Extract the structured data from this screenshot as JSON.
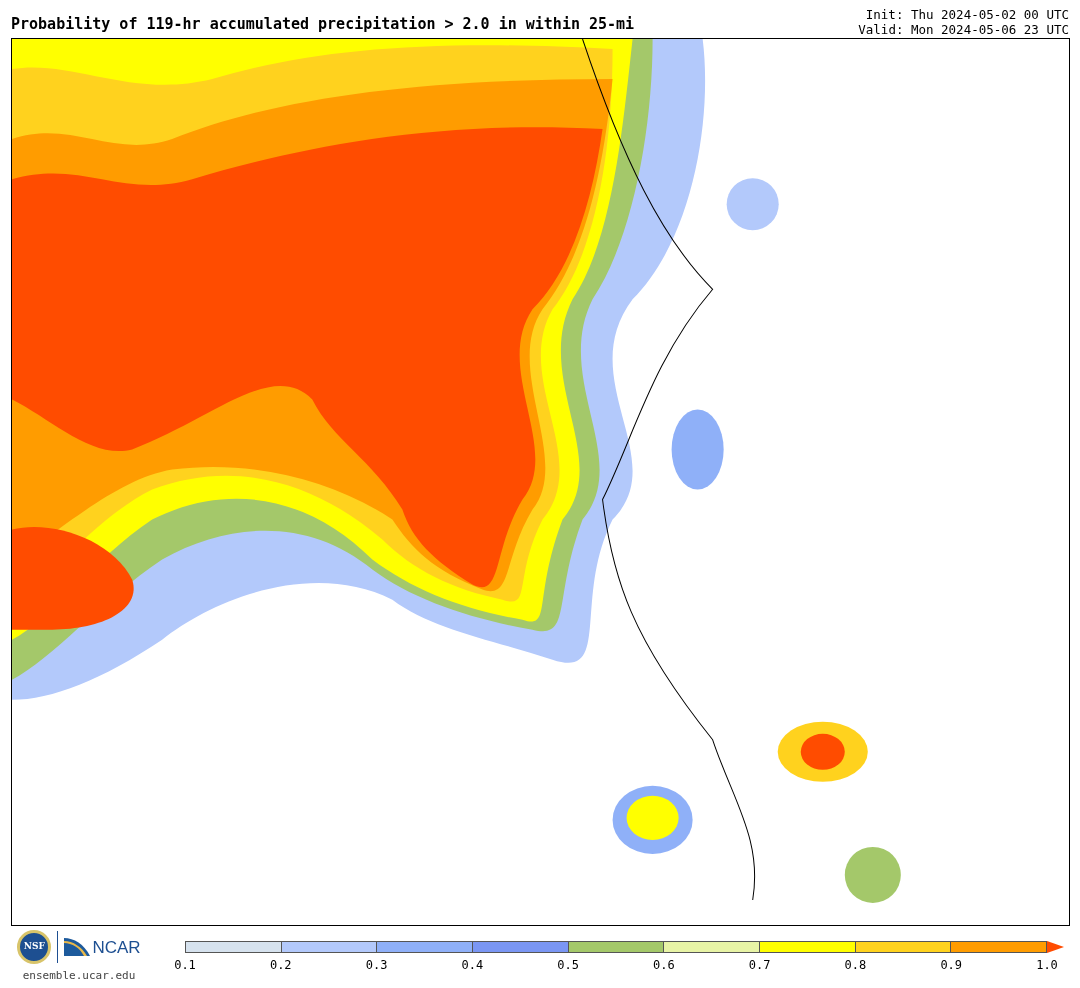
{
  "title": "Probability of 119-hr accumulated precipitation > 2.0 in within 25-mi",
  "init": "Init: Thu 2024-05-02 00 UTC",
  "valid": "Valid: Mon 2024-05-06 23 UTC",
  "logos": {
    "seal": "NSF",
    "org": "NCAR",
    "url": "ensemble.ucar.edu"
  },
  "colorbar": {
    "segments": [
      {
        "color": "#d6e2ee"
      },
      {
        "color": "#b3c9fb"
      },
      {
        "color": "#8fb0f8"
      },
      {
        "color": "#7a96f3"
      },
      {
        "color": "#a4c86a"
      },
      {
        "color": "#e8f4a6"
      },
      {
        "color": "#ffff00"
      },
      {
        "color": "#ffd21e"
      },
      {
        "color": "#ff9c00"
      },
      {
        "kind": "arrow",
        "color": "#ff4c00"
      }
    ],
    "ticks": [
      "0.1",
      "0.2",
      "0.3",
      "0.4",
      "0.5",
      "0.6",
      "0.7",
      "0.8",
      "0.9",
      "1.0"
    ]
  }
}
